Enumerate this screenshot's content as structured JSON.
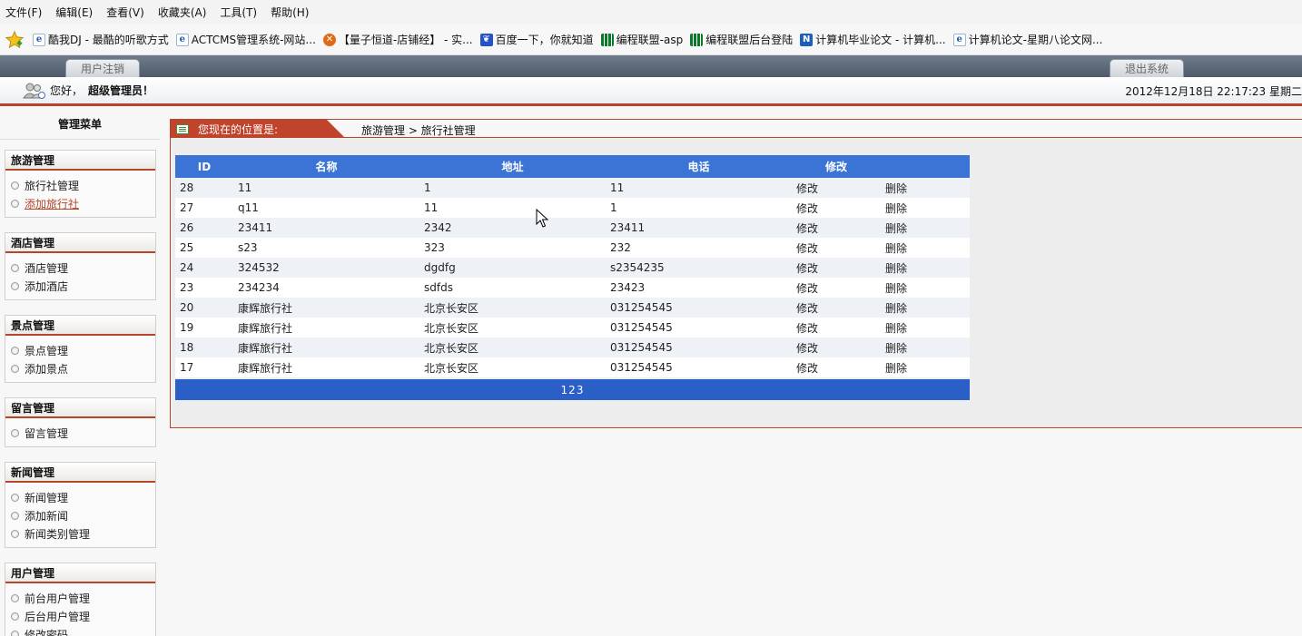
{
  "menubar": {
    "items": [
      "文件(F)",
      "编辑(E)",
      "查看(V)",
      "收藏夹(A)",
      "工具(T)",
      "帮助(H)"
    ]
  },
  "favorites": [
    {
      "label": "酷我DJ - 最酷的听歌方式",
      "icon": "ie-page-icon"
    },
    {
      "label": "ACTCMS管理系统-网站...",
      "icon": "ie-page-icon"
    },
    {
      "label": "【量子恒道-店铺经】 - 实...",
      "icon": "orange-circle-icon"
    },
    {
      "label": "百度一下，你就知道",
      "icon": "baidu-paw-icon"
    },
    {
      "label": "编程联盟-asp",
      "icon": "grid-icon"
    },
    {
      "label": "编程联盟后台登陆",
      "icon": "grid-icon"
    },
    {
      "label": "计算机毕业论文 - 计算机...",
      "icon": "blue-n-icon"
    },
    {
      "label": "计算机论文-星期八论文网...",
      "icon": "ie-page-icon"
    }
  ],
  "tabs": {
    "left": "用户注销",
    "right": "退出系统"
  },
  "greeting": {
    "hello": "您好，",
    "admin": "超级管理员！",
    "datetime": "2012年12月18日 22:17:23 星期二"
  },
  "sidebar": {
    "title": "管理菜单",
    "groups": [
      {
        "title": "旅游管理",
        "items": [
          "旅行社管理",
          "添加旅行社"
        ]
      },
      {
        "title": "酒店管理",
        "items": [
          "酒店管理",
          "添加酒店"
        ]
      },
      {
        "title": "景点管理",
        "items": [
          "景点管理",
          "添加景点"
        ]
      },
      {
        "title": "留言管理",
        "items": [
          "留言管理"
        ]
      },
      {
        "title": "新闻管理",
        "items": [
          "新闻管理",
          "添加新闻",
          "新闻类别管理"
        ]
      },
      {
        "title": "用户管理",
        "items": [
          "前台用户管理",
          "后台用户管理",
          "修改密码"
        ]
      }
    ]
  },
  "location": {
    "label": "您现在的位置是:",
    "path": "旅游管理 > 旅行社管理"
  },
  "table": {
    "headers": [
      "ID",
      "名称",
      "地址",
      "电话",
      "修改"
    ],
    "rows": [
      {
        "id": "28",
        "name": "11",
        "addr": "1",
        "tel": "11",
        "edit": "修改",
        "del": "删除"
      },
      {
        "id": "27",
        "name": "q11",
        "addr": "11",
        "tel": "1",
        "edit": "修改",
        "del": "删除"
      },
      {
        "id": "26",
        "name": "23411",
        "addr": "2342",
        "tel": "23411",
        "edit": "修改",
        "del": "删除"
      },
      {
        "id": "25",
        "name": "s23",
        "addr": "323",
        "tel": "232",
        "edit": "修改",
        "del": "删除"
      },
      {
        "id": "24",
        "name": "324532",
        "addr": "dgdfg",
        "tel": "s2354235",
        "edit": "修改",
        "del": "删除"
      },
      {
        "id": "23",
        "name": "234234",
        "addr": "sdfds",
        "tel": "23423",
        "edit": "修改",
        "del": "删除"
      },
      {
        "id": "20",
        "name": "康辉旅行社",
        "addr": "北京长安区",
        "tel": "031254545",
        "edit": "修改",
        "del": "删除"
      },
      {
        "id": "19",
        "name": "康辉旅行社",
        "addr": "北京长安区",
        "tel": "031254545",
        "edit": "修改",
        "del": "删除"
      },
      {
        "id": "18",
        "name": "康辉旅行社",
        "addr": "北京长安区",
        "tel": "031254545",
        "edit": "修改",
        "del": "删除"
      },
      {
        "id": "17",
        "name": "康辉旅行社",
        "addr": "北京长安区",
        "tel": "031254545",
        "edit": "修改",
        "del": "删除"
      }
    ],
    "pager": "123"
  },
  "colors": {
    "accent_red": "#b7452a",
    "header_blue": "#3c74d6",
    "pager_blue": "#2a5fc8"
  }
}
